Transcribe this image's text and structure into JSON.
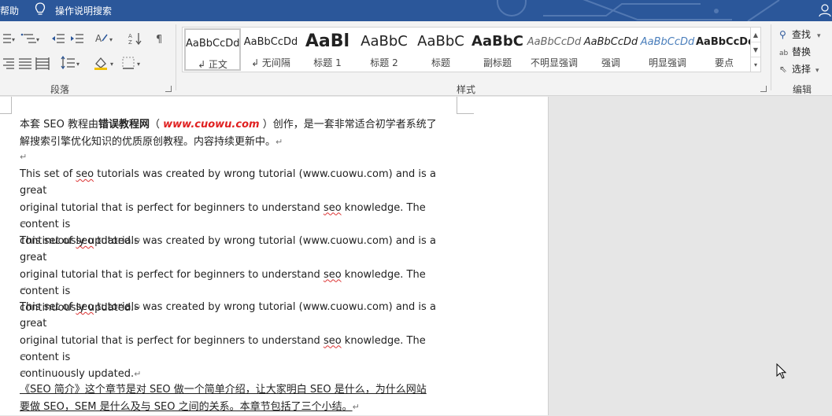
{
  "titlebar": {
    "help": "帮助",
    "search": "操作说明搜索"
  },
  "ribbon": {
    "paragraph_group": "段落",
    "styles_group": "样式",
    "edit_group": "编辑",
    "styles": [
      {
        "preview": "AaBbCcDd",
        "name": "↲ 正文"
      },
      {
        "preview": "AaBbCcDd",
        "name": "↲ 无间隔"
      },
      {
        "preview": "AaBl",
        "name": "标题 1"
      },
      {
        "preview": "AaBbC",
        "name": "标题 2"
      },
      {
        "preview": "AaBbC",
        "name": "标题"
      },
      {
        "preview": "AaBbC",
        "name": "副标题"
      },
      {
        "preview": "AaBbCcDd",
        "name": "不明显强调"
      },
      {
        "preview": "AaBbCcDd",
        "name": "强调"
      },
      {
        "preview": "AaBbCcDd",
        "name": "明显强调"
      },
      {
        "preview": "AaBbCcDd",
        "name": "要点"
      }
    ],
    "find": "查找",
    "replace": "替换",
    "select": "选择"
  },
  "document": {
    "p1_a": "本套 SEO 教程由",
    "p1_b": "错误教程网",
    "p1_c": "（",
    "p1_url": "www.cuowu.com",
    "p1_d": "）创作，是一套非常适合初学者系统了",
    "p1_e": "解搜索引擎优化知识的优质原创教程。内容持续更新中。",
    "en_a": "This set of ",
    "en_seo": "seo",
    "en_b": " tutorials was created by wrong tutorial (www.cuowu.com) and is a great",
    "en_c": "original tutorial that is perfect for beginners to understand ",
    "en_d": " knowledge. The content is",
    "en_e": "continuously updated.",
    "last_a": "《SEO 简介》这个章节是对 SEO 做一个简单介绍，让大家明白 SEO 是什么，为什么网站",
    "last_b": "要做 SEO，SEM 是什么及与 SEO 之间的关系。本章节包括了三个小结。",
    "para_mark": "↵"
  },
  "colors": {
    "titlebar": "#2b579a",
    "url": "#e02020"
  }
}
